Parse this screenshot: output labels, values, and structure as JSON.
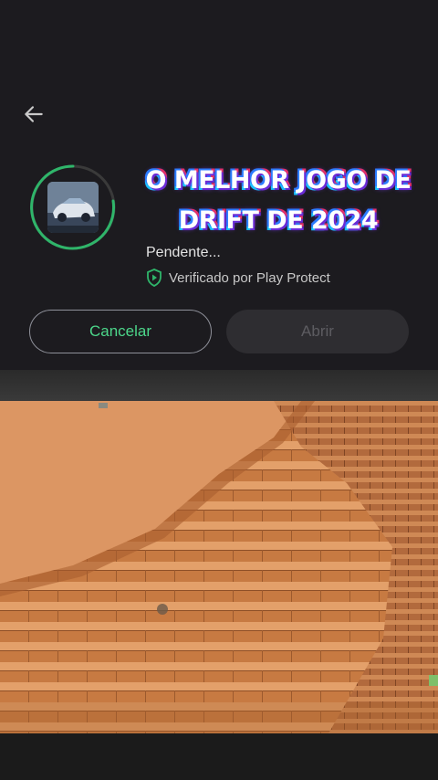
{
  "overlay": {
    "line1": "O MELHOR JOGO DE",
    "line2": "DRIFT DE 2024"
  },
  "app": {
    "status": "Pendente...",
    "verified": "Verificado por Play Protect"
  },
  "buttons": {
    "cancel": "Cancelar",
    "open": "Abrir"
  },
  "icons": {
    "back": "arrow-left-icon",
    "shield": "play-protect-shield-icon"
  },
  "colors": {
    "accent": "#4cd68a",
    "background": "#1c1b1f",
    "disabled": "#5d5c61"
  }
}
